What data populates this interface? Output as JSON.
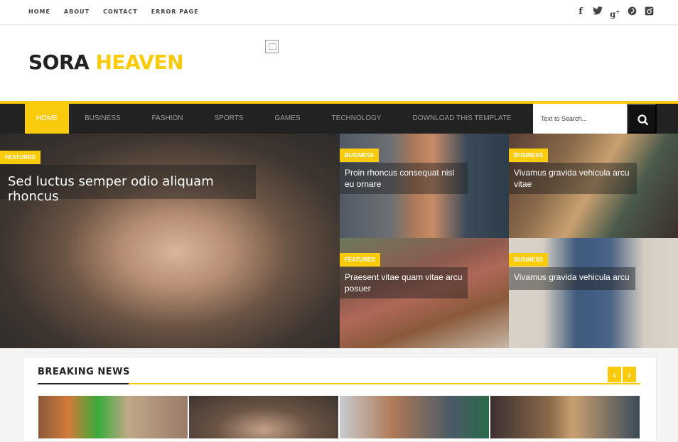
{
  "topbar": {
    "links": [
      "HOME",
      "ABOUT",
      "CONTACT",
      "ERROR PAGE"
    ],
    "social": [
      {
        "name": "facebook-icon",
        "glyph": "f"
      },
      {
        "name": "twitter-icon",
        "glyph": "t"
      },
      {
        "name": "google-plus-icon",
        "glyph": "g+"
      },
      {
        "name": "pinterest-icon",
        "glyph": "p"
      },
      {
        "name": "instagram-icon",
        "glyph": "◙"
      }
    ]
  },
  "header": {
    "logo_part1": "SORA",
    "logo_part2": "HEAVEN"
  },
  "nav": {
    "items": [
      "HOME",
      "BUSINESS",
      "FASHION",
      "SPORTS",
      "GAMES",
      "TECHNOLOGY",
      "DOWNLOAD THIS TEMPLATE"
    ],
    "active": "HOME",
    "search_placeholder": "Text to Search..."
  },
  "hero": {
    "main": {
      "badge": "FEATURED",
      "title": "Sed luctus semper odio aliquam rhoncus"
    },
    "tiles": [
      {
        "badge": "BUSINESS",
        "title": "Proin rhoncus consequat nisl eu ornare"
      },
      {
        "badge": "BUSINESS",
        "title": "Vivamus gravida vehicula arcu vitae"
      },
      {
        "badge": "FEATURED",
        "title": "Praesent vitae quam vitae arcu posuer"
      },
      {
        "badge": "BUSINESS",
        "title": "Vivamus gravida vehicula arcu"
      }
    ]
  },
  "breaking": {
    "title": "BREAKING NEWS",
    "prev": "‹",
    "next": "›"
  },
  "colors": {
    "accent": "#f9cb0b",
    "nav_bg": "#222222",
    "search_btn": "#111111"
  }
}
